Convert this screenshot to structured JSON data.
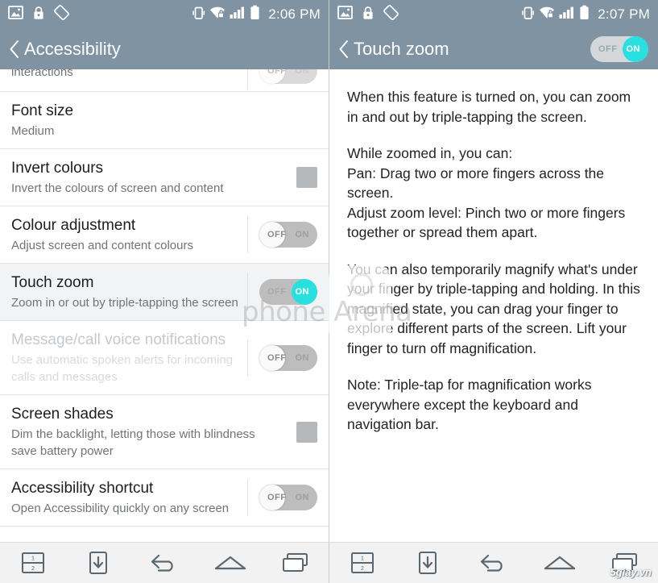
{
  "left_panel": {
    "statusbar": {
      "icons": [
        "image-icon",
        "lock-icon",
        "rotation-lock-icon",
        "vibrate-icon",
        "wifi-secured-icon",
        "signal-icon",
        "battery-icon"
      ],
      "clock": "2:06 PM"
    },
    "actionbar": {
      "back_label": "back-chevron",
      "title": "Accessibility"
    },
    "clipped_row": {
      "sub": "interactions"
    },
    "rows": [
      {
        "title": "Font size",
        "sub": "Medium",
        "control": "none",
        "state": "",
        "disabled": false,
        "selected": false
      },
      {
        "title": "Invert colours",
        "sub": "Invert the colours of screen and content",
        "control": "checkbox",
        "state": "unchecked",
        "disabled": false,
        "selected": false
      },
      {
        "title": "Colour adjustment",
        "sub": "Adjust screen and content colours",
        "control": "toggle",
        "state": "off",
        "disabled": false,
        "selected": false
      },
      {
        "title": "Touch zoom",
        "sub": "Zoom in or out by triple-tapping the screen",
        "control": "toggle",
        "state": "on",
        "disabled": false,
        "selected": true
      },
      {
        "title": "Message/call voice notifications",
        "sub": "Use automatic spoken alerts for incoming calls and messages",
        "control": "toggle",
        "state": "off",
        "disabled": true,
        "selected": false
      },
      {
        "title": "Screen shades",
        "sub": "Dim the backlight, letting those with blindness save battery power",
        "control": "checkbox",
        "state": "unchecked",
        "disabled": false,
        "selected": false
      },
      {
        "title": "Accessibility shortcut",
        "sub": "Open Accessibility quickly on any screen",
        "control": "toggle",
        "state": "off",
        "disabled": false,
        "selected": false
      }
    ]
  },
  "right_panel": {
    "statusbar": {
      "clock": "2:07 PM"
    },
    "actionbar": {
      "title": "Touch zoom",
      "toggle_state": "on"
    },
    "paragraphs": [
      "When this feature is turned on, you can zoom in and out by triple-tapping the screen.",
      "While zoomed in, you can:\nPan: Drag two or more fingers across the screen.\nAdjust zoom level: Pinch two or more fingers together or spread them apart.",
      "You can also temporarily magnify what's under your finger by triple-tapping and holding. In this magnified state, you can drag your finger to explore different parts of the screen. Lift your finger to turn off magnification.",
      "Note: Triple-tap for magnification works everywhere except the keyboard and navigation bar."
    ]
  },
  "toggle_labels": {
    "off": "OFF",
    "on": "ON"
  },
  "navbar": {
    "buttons": [
      {
        "name": "dual-window-icon",
        "label": "Dual window"
      },
      {
        "name": "capture-plus-icon",
        "label": "Capture plus"
      },
      {
        "name": "back-icon",
        "label": "Back"
      },
      {
        "name": "home-icon",
        "label": "Home"
      },
      {
        "name": "recent-apps-icon",
        "label": "Recent apps"
      }
    ]
  },
  "watermarks": {
    "phonearena": "phone Arena",
    "site": "5giay.vn"
  },
  "colors": {
    "header": "#7f93a3",
    "accent_on": "#29e0e0",
    "toggle_track": "#bdbdbd",
    "checkbox": "#b5b8ba",
    "selected_row": "#f2f3f4"
  }
}
